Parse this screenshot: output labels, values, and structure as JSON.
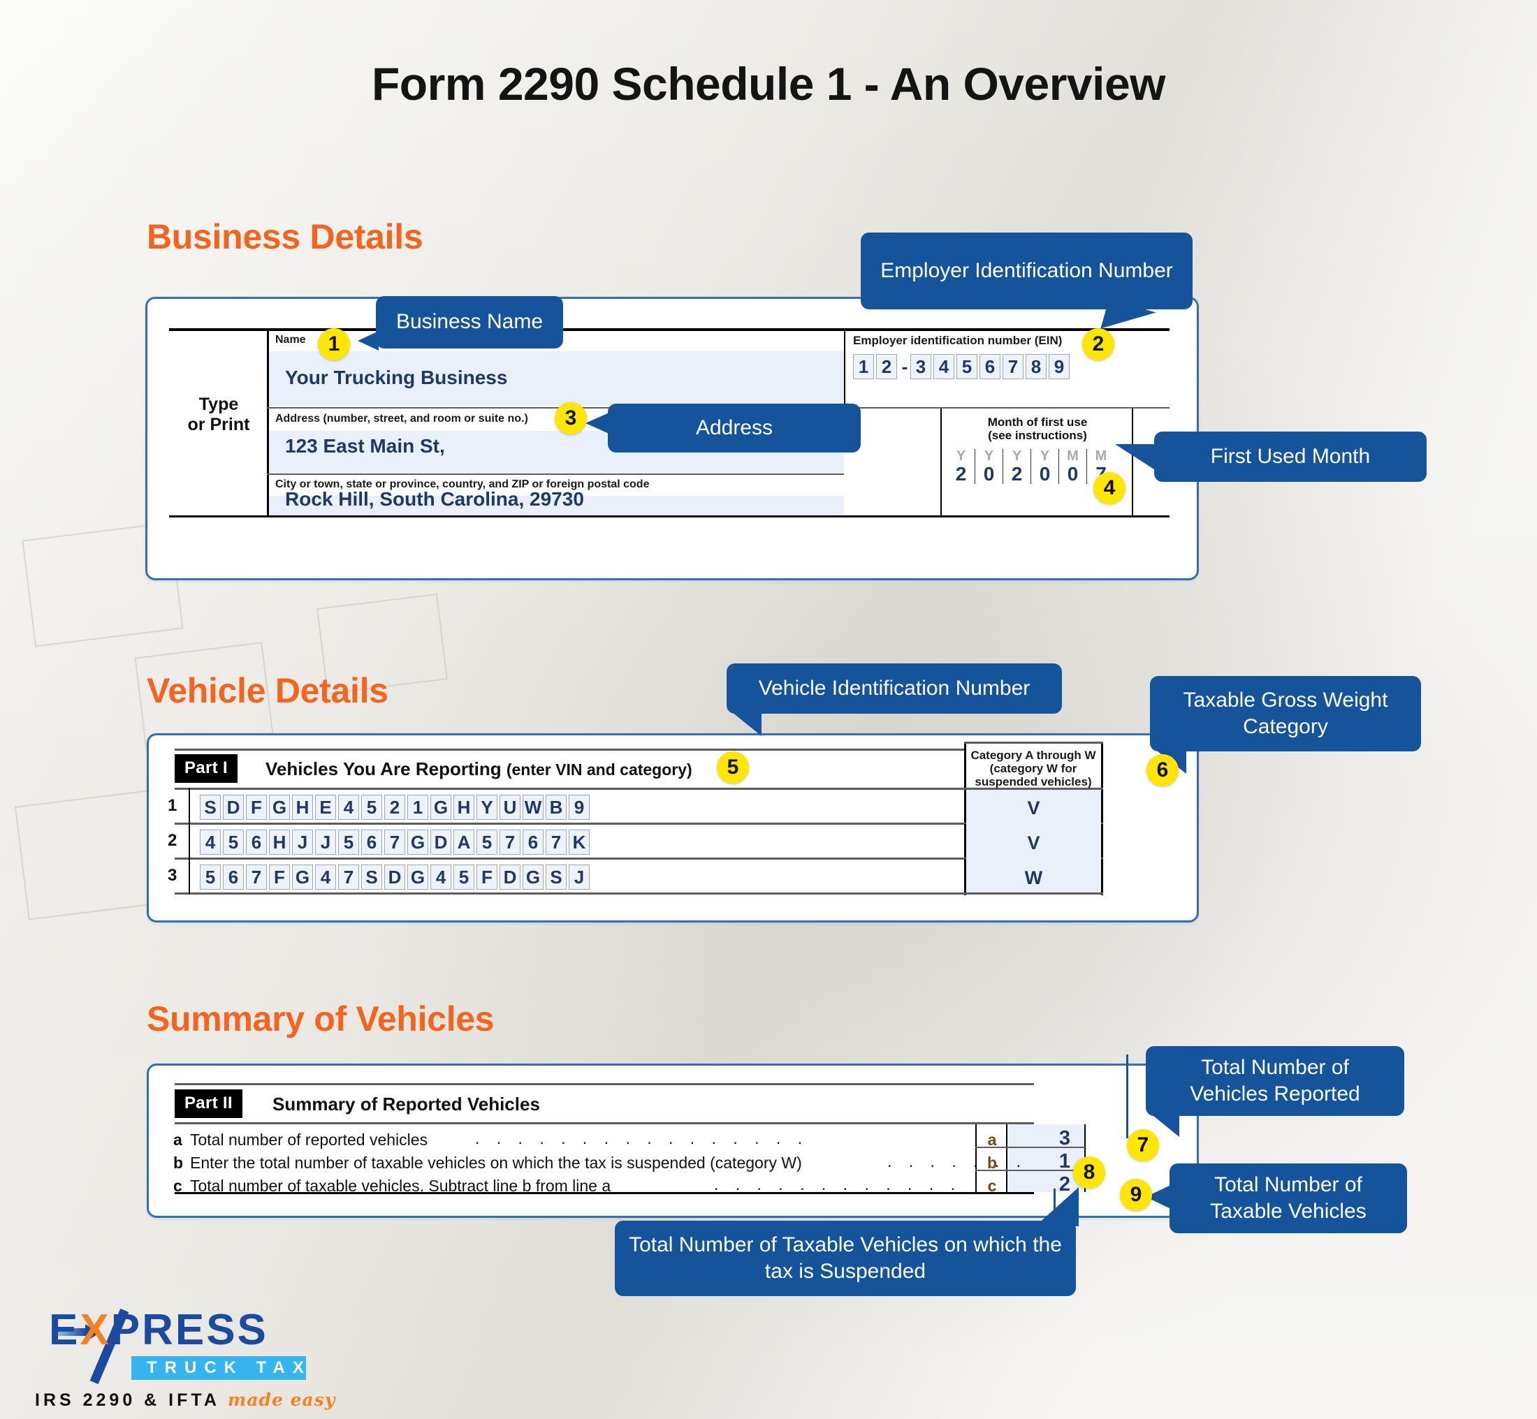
{
  "page": {
    "title": "Form 2290 Schedule 1 - An Overview",
    "accent_orange": "#F4641E",
    "callout_blue": "#15539A",
    "badge_yellow": "#FFE600"
  },
  "sections": [
    {
      "heading": "Business Details"
    },
    {
      "heading": "Vehicle Details"
    },
    {
      "heading": "Summary of Vehicles"
    }
  ],
  "business_form": {
    "type_or_print": "Type\nor Print",
    "type_or_print_line1": "Type",
    "type_or_print_line2": "or Print",
    "name_label": "Name",
    "name_value": "Your Trucking Business",
    "address_label": "Address (number, street, and room or suite no.)",
    "address_value": "123 East Main St,",
    "city_label": "City or town, state or province, country, and ZIP or foreign postal code",
    "city_value": "Rock Hill, South Carolina, 29730",
    "ein_label": "Employer identification number (EIN)",
    "ein_digits": [
      "1",
      "2",
      "-",
      "3",
      "4",
      "5",
      "6",
      "7",
      "8",
      "9"
    ],
    "first_use_label_line1": "Month of first use",
    "first_use_label_line2": "(see instructions)",
    "first_use_headers": [
      "Y",
      "Y",
      "Y",
      "Y",
      "M",
      "M"
    ],
    "first_use_digits": [
      "2",
      "0",
      "2",
      "0",
      "0",
      "7"
    ]
  },
  "vehicle_form": {
    "part_tag": "Part I",
    "part_title": "Vehicles You Are Reporting",
    "part_title_sub": "(enter VIN and category)",
    "category_header": "Category A through W (category W for suspended vehicles)",
    "category_header_lines": [
      "Category A through W",
      "(category W for",
      "suspended vehicles)"
    ],
    "rows": [
      {
        "num": "1",
        "vin": [
          "S",
          "D",
          "F",
          "G",
          "H",
          "E",
          "4",
          "5",
          "2",
          "1",
          "G",
          "H",
          "Y",
          "U",
          "W",
          "B",
          "9"
        ],
        "category": "V"
      },
      {
        "num": "2",
        "vin": [
          "4",
          "5",
          "6",
          "H",
          "J",
          "J",
          "5",
          "6",
          "7",
          "G",
          "D",
          "A",
          "5",
          "7",
          "6",
          "7",
          "K"
        ],
        "category": "V"
      },
      {
        "num": "3",
        "vin": [
          "5",
          "6",
          "7",
          "F",
          "G",
          "4",
          "7",
          "S",
          "D",
          "G",
          "4",
          "5",
          "F",
          "D",
          "G",
          "S",
          "J"
        ],
        "category": "W"
      }
    ]
  },
  "summary_form": {
    "part_tag": "Part II",
    "part_title": "Summary of Reported Vehicles",
    "lines": [
      {
        "letter": "a",
        "text": "Total number of reported vehicles",
        "dots": ". . . . . . . . . . . . . . . .",
        "box": "a",
        "value": "3"
      },
      {
        "letter": "b",
        "text": "Enter the total number of taxable vehicles on which the tax is suspended (category W)",
        "dots": ". . . . . . .",
        "box": "b",
        "value": "1"
      },
      {
        "letter": "c",
        "text": "Total number of taxable vehicles. Subtract line b from line a",
        "dots": ". . . . . . . . . . . .",
        "box": "c",
        "value": "2"
      }
    ]
  },
  "callouts": [
    {
      "id": "1",
      "text": "Business Name"
    },
    {
      "id": "2",
      "text": "Employer Identification Number"
    },
    {
      "id": "3",
      "text": "Address"
    },
    {
      "id": "4",
      "text": "First Used Month"
    },
    {
      "id": "5",
      "text": "Vehicle Identification Number"
    },
    {
      "id": "6",
      "text": "Taxable Gross Weight Category"
    },
    {
      "id": "7",
      "text": "Total Number of Vehicles Reported"
    },
    {
      "id": "8",
      "text": "Total Number of Taxable Vehicles on which the tax is Suspended"
    },
    {
      "id": "9",
      "text": "Total Number of Taxable Vehicles"
    }
  ],
  "logo": {
    "word_e": "E",
    "word_x": "X",
    "word_press": "PRESS",
    "bar_text": "TRUCK TAX",
    "tagline_main": "IRS 2290 & IFTA",
    "tagline_script": "made easy"
  }
}
